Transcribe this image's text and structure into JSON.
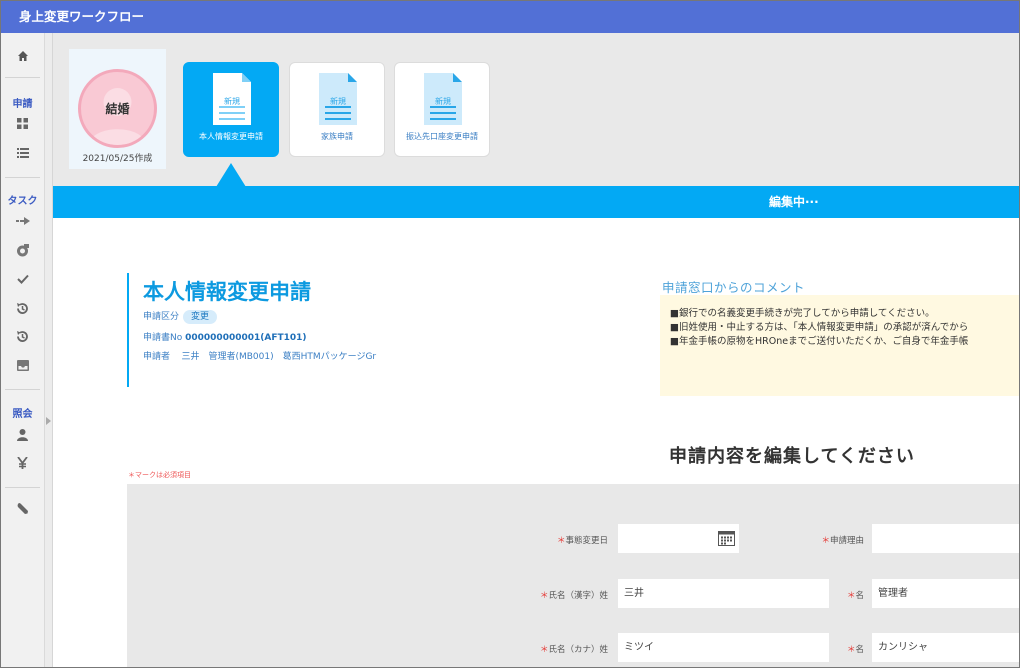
{
  "app": {
    "title": "身上変更ワークフロー"
  },
  "sidebar": {
    "sections": [
      {
        "label": "申請"
      },
      {
        "label": "タスク"
      },
      {
        "label": "照会"
      }
    ],
    "icons": [
      "home-icon",
      "grid-icon",
      "list-icon",
      "arrow-right-icon",
      "badge-icon",
      "check-icon",
      "history-icon",
      "history-icon",
      "inbox-icon",
      "person-icon",
      "yen-icon",
      "wrench-icon"
    ]
  },
  "profile": {
    "status": "結婚",
    "date": "2021/05/25作成"
  },
  "cards": [
    {
      "doc_label": "新規",
      "label": "本人情報変更申請",
      "active": true
    },
    {
      "doc_label": "新規",
      "label": "家族申請",
      "active": false
    },
    {
      "doc_label": "新規",
      "label": "振込先口座変更申請",
      "active": false
    }
  ],
  "banner": {
    "text": "編集中···"
  },
  "request": {
    "title": "本人情報変更申請",
    "category_label": "申請区分",
    "category_value": "変更",
    "number_label": "申請書No",
    "number_value": "000000000001(AFT101)",
    "applicant_label": "申請者",
    "applicant_value": "三井　管理者(MB001)　葛西HTMパッケージGr"
  },
  "comment": {
    "title": "申請窓口からのコメント",
    "lines": [
      "■銀行での名義変更手続きが完了してから申請してください。",
      "■旧姓使用・中止する方は、「本人情報変更申請」の承認が済んでから",
      "■年金手帳の原物をHROneまでご送付いただくか、ご自身で年金手帳"
    ]
  },
  "form": {
    "heading": "申請内容を編集してください",
    "required_note": "＊マークは必須項目",
    "fields": {
      "event_date": {
        "label": "事態変更日",
        "value": ""
      },
      "reason": {
        "label": "申請理由",
        "value": ""
      },
      "name_kanji_last": {
        "label": "氏名（漢字）姓",
        "value": "三井"
      },
      "name_kanji_first": {
        "label": "名",
        "value": "管理者"
      },
      "name_kana_last": {
        "label": "氏名（カナ）姓",
        "value": "ミツイ"
      },
      "name_kana_first": {
        "label": "名",
        "value": "カンリシャ"
      }
    },
    "required_mark": "＊"
  },
  "colors": {
    "titlebar": "#5270d6",
    "accent": "#03a9f4",
    "sidebar_label": "#3b5bc2",
    "comment_bg": "#fff9e1"
  }
}
